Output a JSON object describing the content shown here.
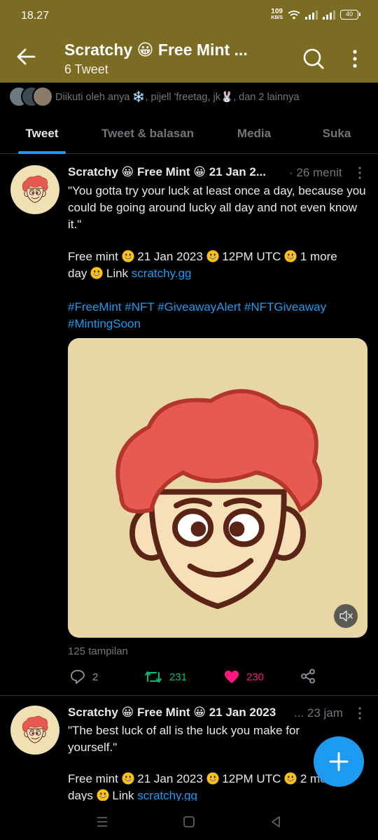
{
  "status_bar": {
    "time": "18.27",
    "net_speed": "109",
    "net_unit": "KB/S",
    "battery": "40"
  },
  "header": {
    "title": "Scratchy 😀 Free Mint ...",
    "subtitle": "6 Tweet"
  },
  "followed_by": {
    "text": "Diikuti oleh anya ❄️, pijell 'freetag, jk🐰, dan 2 lainnya"
  },
  "tabs": [
    {
      "label": "Tweet",
      "active": true
    },
    {
      "label": "Tweet & balasan",
      "active": false
    },
    {
      "label": "Media",
      "active": false
    },
    {
      "label": "Suka",
      "active": false
    }
  ],
  "tweets": [
    {
      "author": "Scratchy 😀 Free Mint 😀 21 Jan 2...",
      "time": "· 26 menit",
      "quote": "\"You gotta try your luck at least once a day, because you could be going around lucky all day and not even know it.\"",
      "line1_a": "Free mint ",
      "line1_b": " 21 Jan 2023 ",
      "line1_c": " 12PM UTC ",
      "line1_d": " 1 more",
      "line2_a": "day ",
      "line2_b": " Link ",
      "link": "scratchy.gg",
      "hashtags_1": "#FreeMint #NFT #GiveawayAlert #NFTGiveaway",
      "hashtags_2": "#MintingSoon",
      "views": "125 tampilan",
      "replies": "2",
      "retweets": "231",
      "likes": "230"
    },
    {
      "author": "Scratchy 😀 Free Mint 😀 21 Jan 2023",
      "time": "... 23 jam",
      "quote": "\"The best luck of all is the luck you make for yourself.\"",
      "line1_a": "Free mint ",
      "line1_b": " 21 Jan 2023 ",
      "line1_c": " 12PM UTC ",
      "line1_d": " 2 more",
      "line2_a": "days ",
      "line2_b": " Link ",
      "link": "scratchy.gg"
    }
  ],
  "colors": {
    "header_bg": "#7c6b22",
    "accent": "#1d9bf0",
    "retweet": "#00ba7c",
    "like": "#f91880"
  },
  "icons": {
    "back": "arrow-left-icon",
    "search": "search-icon",
    "more": "more-vertical-icon",
    "reply": "reply-icon",
    "retweet": "retweet-icon",
    "like": "heart-icon",
    "share": "share-icon",
    "mute": "mute-icon",
    "compose": "plus-icon"
  }
}
